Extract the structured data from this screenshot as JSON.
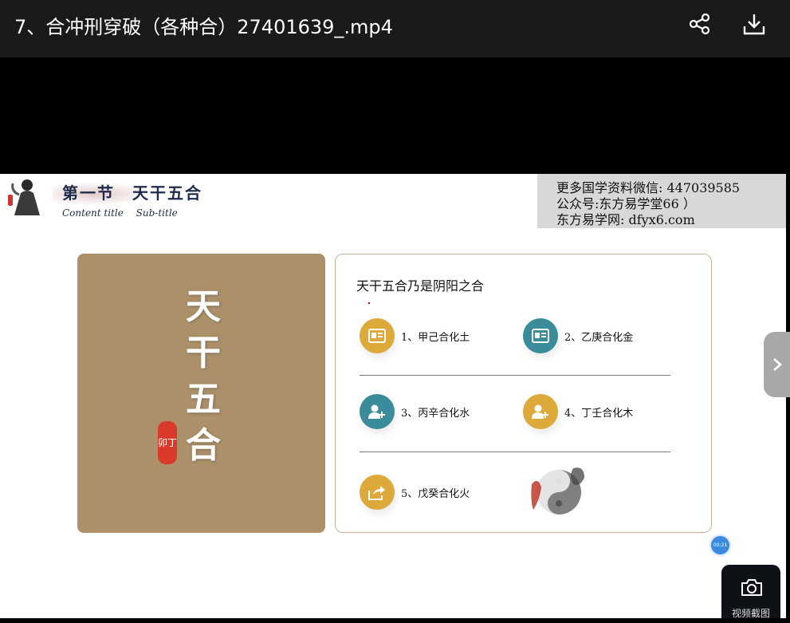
{
  "header": {
    "title": "7、合冲刑穿破（各种合）27401639_.mp4"
  },
  "slide": {
    "section_title": "第一节　天干五合",
    "section_subtitle": "Content title　 Sub-title",
    "watermark": {
      "line1": "更多国学资料微信: 447039585",
      "line2": "公众号:东方易学堂66 ）",
      "line3": "东方易学网: dfyx6.com"
    },
    "big_title": [
      "天",
      "干",
      "五",
      "合"
    ],
    "seal_text": "卯丁",
    "card_heading": "天干五合乃是阴阳之合",
    "items": [
      {
        "label": "1、甲己合化土",
        "color": "#dca93a",
        "icon": "id-card-icon"
      },
      {
        "label": "2、乙庚合化金",
        "color": "#3a8c9a",
        "icon": "id-card-icon"
      },
      {
        "label": "3、丙辛合化水",
        "color": "#3a8c9a",
        "icon": "add-user-icon"
      },
      {
        "label": "4、丁壬合化木",
        "color": "#dca93a",
        "icon": "add-user-icon"
      },
      {
        "label": "5、戊癸合化火",
        "color": "#dca93a",
        "icon": "share-arrow-icon"
      }
    ]
  },
  "player": {
    "timer": "00:21",
    "screenshot_label": "视频截图"
  },
  "colors": {
    "accent_gold": "#dca93a",
    "accent_teal": "#3a8c9a",
    "card_brown": "#ab906a"
  }
}
